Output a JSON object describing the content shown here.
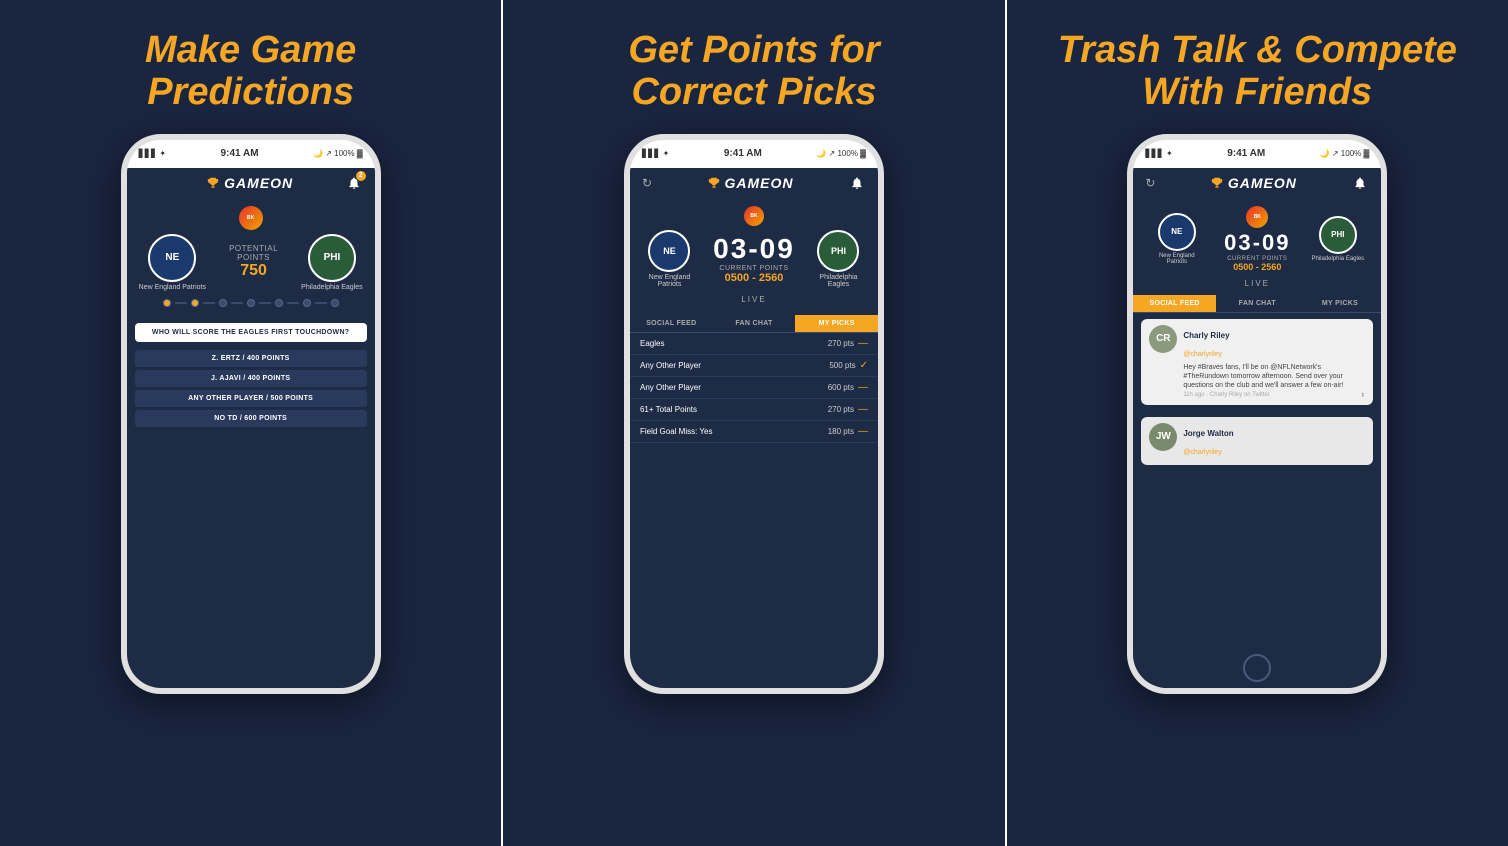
{
  "panels": [
    {
      "id": "panel-1",
      "title": "Make Game\nPredictions",
      "phone": {
        "time": "9:41 AM",
        "app_name": "GAMEON",
        "notification_count": "2",
        "bk_sponsor": "BK",
        "team_home": {
          "abbr": "NE",
          "name": "New England Patriots",
          "class": "ne"
        },
        "team_away": {
          "abbr": "PHI",
          "name": "Philadelphia Eagles",
          "class": "phi"
        },
        "middle_label": "POTENTIAL POINTS",
        "middle_value": "750",
        "question": "WHO WILL SCORE THE EAGLES FIRST TOUCHDOWN?",
        "answers": [
          "Z. ERTZ / 400 POINTS",
          "J. AJAVI / 400 POINTS",
          "ANY OTHER PLAYER / 500 POINTS",
          "NO TD / 600 POINTS"
        ],
        "progress_dots": [
          1,
          2,
          3,
          4,
          5,
          6,
          7,
          8
        ]
      }
    },
    {
      "id": "panel-2",
      "title": "Get Points for\nCorrect Picks",
      "phone": {
        "time": "9:41 AM",
        "app_name": "GAMEON",
        "bk_sponsor": "BK",
        "team_home": {
          "abbr": "NE",
          "name": "New England\nPatriots",
          "class": "ne"
        },
        "team_away": {
          "abbr": "PHI",
          "name": "Philadelphia\nEagles",
          "class": "phi"
        },
        "score": "03-09",
        "current_points_label": "CURRENT POINTS",
        "current_points_value": "0500 - 2560",
        "live_label": "LIVE",
        "tabs": [
          "SOCIAL FEED",
          "FAN CHAT",
          "MY PICKS"
        ],
        "active_tab": "MY PICKS",
        "picks": [
          {
            "name": "Eagles",
            "pts": "270 pts",
            "status": "dash"
          },
          {
            "name": "Any Other Player",
            "pts": "500 pts",
            "status": "check"
          },
          {
            "name": "Any Other Player",
            "pts": "600 pts",
            "status": "dash"
          },
          {
            "name": "61+ Total Points",
            "pts": "270 pts",
            "status": "dash"
          },
          {
            "name": "Field Goal Miss: Yes",
            "pts": "180 pts",
            "status": "dash"
          }
        ]
      }
    },
    {
      "id": "panel-3",
      "title": "Trash Talk & Compete\nWith Friends",
      "phone": {
        "time": "9:41 AM",
        "app_name": "GAMEON",
        "bk_sponsor": "BK",
        "team_home": {
          "abbr": "NE",
          "name": "New England Patriots",
          "class": "ne"
        },
        "team_away": {
          "abbr": "PHI",
          "name": "Philadelphia Eagles",
          "class": "phi"
        },
        "score": "03-09",
        "current_points_label": "CURRENT POINTS",
        "current_points_value": "0500 - 2560",
        "live_label": "LIVE",
        "tabs": [
          "SOCIAL FEED",
          "FAN CHAT",
          "MY PICKS"
        ],
        "active_tab": "SOCIAL FEED",
        "messages": [
          {
            "username": "Charly Riley",
            "handle": "@charlyriley",
            "text": "Hey #Braves fans, I'll be on @NFLNetwork's #TheRundown tomorrow afternoon. Send over your questions on the club and we'll answer a few on-air!",
            "time": "11h ago",
            "source": "Charly Riley on Twitter"
          },
          {
            "username": "Jorge Walton",
            "handle": "@charlyriley",
            "text": "",
            "time": "",
            "source": ""
          }
        ]
      }
    }
  ]
}
